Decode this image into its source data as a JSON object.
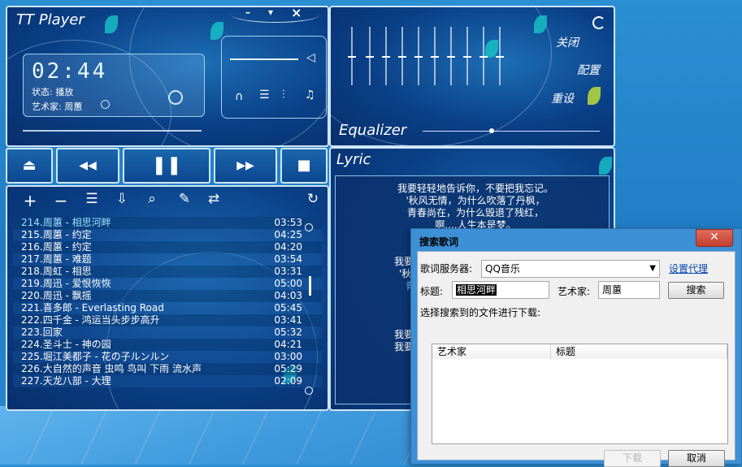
{
  "player": {
    "title": "TT Player",
    "window_controls": {
      "minimize": "–",
      "menu": "▾",
      "close": "×"
    },
    "time": "02:44",
    "status": "状态: 播放",
    "artist": "艺术家: 周蕙",
    "volume_percent": 100
  },
  "transport": {
    "eject": "⏏",
    "prev": "◀◀",
    "pause": "❚❚",
    "next": "▶▶",
    "stop": "■"
  },
  "toolbar_icons": [
    "add-icon",
    "remove-icon",
    "list-icon",
    "download-icon",
    "search-icon",
    "edit-icon",
    "swap-icon"
  ],
  "playlist": {
    "items": [
      {
        "title": "214.周蕙 - 相思河畔",
        "time": "03:53",
        "current": true
      },
      {
        "title": "215.周蕙 - 约定",
        "time": "04:25"
      },
      {
        "title": "216.周蕙 - 约定",
        "time": "04:20"
      },
      {
        "title": "217.周蕙 - 难题",
        "time": "03:54"
      },
      {
        "title": "218.周虹 - 相思",
        "time": "03:31"
      },
      {
        "title": "219.周迅 - 爱恨恢恢",
        "time": "05:00"
      },
      {
        "title": "220.周迅 - 飘摇",
        "time": "04:03"
      },
      {
        "title": "221.喜多郎 - Everlasting Road",
        "time": "05:45"
      },
      {
        "title": "222.四千金 - 鸿运当头步步高升",
        "time": "03:41"
      },
      {
        "title": "223.回家",
        "time": "05:32"
      },
      {
        "title": "224.圣斗士 - 神の园",
        "time": "04:21"
      },
      {
        "title": "225.堀江美都子 - 花の子ルンルン",
        "time": "03:00"
      },
      {
        "title": "226.大自然的声音 虫鸣 鸟叫 下雨 流水声",
        "time": "05:29"
      },
      {
        "title": "227.天龙八部 - 大理",
        "time": "02:09"
      }
    ]
  },
  "equalizer": {
    "title": "Equalizer",
    "menu": {
      "close": "关闭",
      "config": "配置",
      "reset": "重设"
    }
  },
  "lyric": {
    "title": "Lyric",
    "lines": [
      "我要轻轻地告诉你，不要把我忘记。",
      "'秋风无情，为什么吹落了丹枫，",
      "青春尚在，为什么毁退了残红，",
      "啊....人生本是梦。"
    ],
    "partial_lines": [
      "我要",
      "'秋",
      "青",
      "我要",
      "我要"
    ]
  },
  "dialog": {
    "title": "搜索歌词",
    "close_symbol": "✕",
    "server_label": "歌词服务器:",
    "server_value": "QQ音乐",
    "proxy_link": "设置代理",
    "title_label": "标题:",
    "title_value": "相思河畔",
    "artist_label": "艺术家:",
    "artist_value": "周蕙",
    "search_button": "搜索",
    "instruction": "选择搜索到的文件进行下载:",
    "columns": [
      "艺术家",
      "标题"
    ],
    "download_button": "下载",
    "cancel_button": "取消"
  }
}
